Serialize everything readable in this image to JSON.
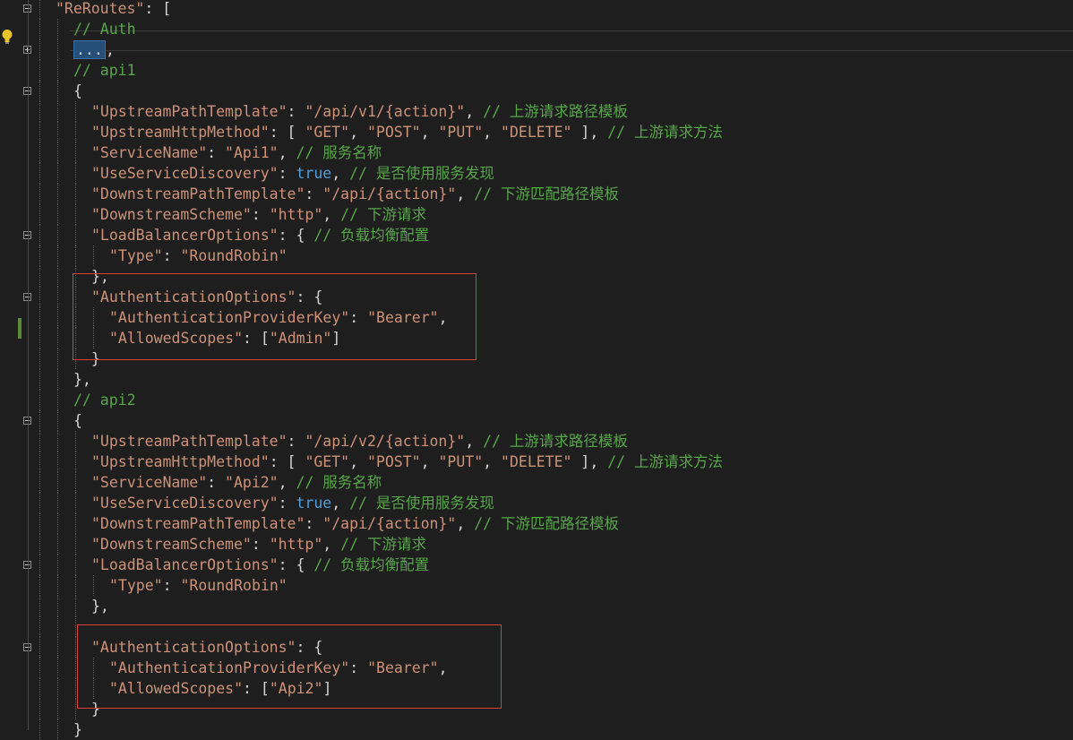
{
  "editor": {
    "language": "json",
    "lines": [
      {
        "indent": 0,
        "tokens": [
          {
            "t": "\"ReRoutes\"",
            "c": "k"
          },
          {
            "t": ": [",
            "c": "p"
          }
        ],
        "fold": "minus"
      },
      {
        "indent": 1,
        "tokens": [
          {
            "t": "// Auth",
            "c": "c"
          }
        ]
      },
      {
        "indent": 1,
        "tokens": [
          {
            "t": "...",
            "c": "collapsed"
          },
          {
            "t": ",",
            "c": "p"
          }
        ],
        "fold": "plus"
      },
      {
        "indent": 1,
        "tokens": [
          {
            "t": "// api1",
            "c": "c"
          }
        ]
      },
      {
        "indent": 1,
        "tokens": [
          {
            "t": "{",
            "c": "p"
          }
        ],
        "fold": "minus"
      },
      {
        "indent": 2,
        "tokens": [
          {
            "t": "\"UpstreamPathTemplate\"",
            "c": "k"
          },
          {
            "t": ": ",
            "c": "p"
          },
          {
            "t": "\"/api/v1/{action}\"",
            "c": "s"
          },
          {
            "t": ", ",
            "c": "p"
          },
          {
            "t": "// 上游请求路径模板",
            "c": "c"
          }
        ]
      },
      {
        "indent": 2,
        "tokens": [
          {
            "t": "\"UpstreamHttpMethod\"",
            "c": "k"
          },
          {
            "t": ": [ ",
            "c": "p"
          },
          {
            "t": "\"GET\"",
            "c": "s"
          },
          {
            "t": ", ",
            "c": "p"
          },
          {
            "t": "\"POST\"",
            "c": "s"
          },
          {
            "t": ", ",
            "c": "p"
          },
          {
            "t": "\"PUT\"",
            "c": "s"
          },
          {
            "t": ", ",
            "c": "p"
          },
          {
            "t": "\"DELETE\"",
            "c": "s"
          },
          {
            "t": " ], ",
            "c": "p"
          },
          {
            "t": "// 上游请求方法",
            "c": "c"
          }
        ]
      },
      {
        "indent": 2,
        "tokens": [
          {
            "t": "\"ServiceName\"",
            "c": "k"
          },
          {
            "t": ": ",
            "c": "p"
          },
          {
            "t": "\"Api1\"",
            "c": "s"
          },
          {
            "t": ", ",
            "c": "p"
          },
          {
            "t": "// 服务名称",
            "c": "c"
          }
        ]
      },
      {
        "indent": 2,
        "tokens": [
          {
            "t": "\"UseServiceDiscovery\"",
            "c": "k"
          },
          {
            "t": ": ",
            "c": "p"
          },
          {
            "t": "true",
            "c": "b"
          },
          {
            "t": ", ",
            "c": "p"
          },
          {
            "t": "// 是否使用服务发现",
            "c": "c"
          }
        ]
      },
      {
        "indent": 2,
        "tokens": [
          {
            "t": "\"DownstreamPathTemplate\"",
            "c": "k"
          },
          {
            "t": ": ",
            "c": "p"
          },
          {
            "t": "\"/api/{action}\"",
            "c": "s"
          },
          {
            "t": ", ",
            "c": "p"
          },
          {
            "t": "// 下游匹配路径模板",
            "c": "c"
          }
        ]
      },
      {
        "indent": 2,
        "tokens": [
          {
            "t": "\"DownstreamScheme\"",
            "c": "k"
          },
          {
            "t": ": ",
            "c": "p"
          },
          {
            "t": "\"http\"",
            "c": "s"
          },
          {
            "t": ", ",
            "c": "p"
          },
          {
            "t": "// 下游请求",
            "c": "c"
          }
        ]
      },
      {
        "indent": 2,
        "tokens": [
          {
            "t": "\"LoadBalancerOptions\"",
            "c": "k"
          },
          {
            "t": ": { ",
            "c": "p"
          },
          {
            "t": "// 负载均衡配置",
            "c": "c"
          }
        ],
        "fold": "minus"
      },
      {
        "indent": 3,
        "tokens": [
          {
            "t": "\"Type\"",
            "c": "k"
          },
          {
            "t": ": ",
            "c": "p"
          },
          {
            "t": "\"RoundRobin\"",
            "c": "s"
          }
        ]
      },
      {
        "indent": 2,
        "tokens": [
          {
            "t": "},",
            "c": "p"
          }
        ]
      },
      {
        "indent": 2,
        "tokens": [
          {
            "t": "\"AuthenticationOptions\"",
            "c": "k"
          },
          {
            "t": ": {",
            "c": "p"
          }
        ],
        "fold": "minus"
      },
      {
        "indent": 3,
        "tokens": [
          {
            "t": "\"AuthenticationProviderKey\"",
            "c": "k"
          },
          {
            "t": ": ",
            "c": "p"
          },
          {
            "t": "\"Bearer\"",
            "c": "s"
          },
          {
            "t": ",",
            "c": "p"
          }
        ]
      },
      {
        "indent": 3,
        "tokens": [
          {
            "t": "\"AllowedScopes\"",
            "c": "k"
          },
          {
            "t": ": [",
            "c": "p"
          },
          {
            "t": "\"Admin\"",
            "c": "s"
          },
          {
            "t": "]",
            "c": "p"
          }
        ]
      },
      {
        "indent": 2,
        "tokens": [
          {
            "t": "}",
            "c": "p"
          }
        ]
      },
      {
        "indent": 1,
        "tokens": [
          {
            "t": "},",
            "c": "p"
          }
        ]
      },
      {
        "indent": 1,
        "tokens": [
          {
            "t": "// api2",
            "c": "c"
          }
        ]
      },
      {
        "indent": 1,
        "tokens": [
          {
            "t": "{",
            "c": "p"
          }
        ],
        "fold": "minus"
      },
      {
        "indent": 2,
        "tokens": [
          {
            "t": "\"UpstreamPathTemplate\"",
            "c": "k"
          },
          {
            "t": ": ",
            "c": "p"
          },
          {
            "t": "\"/api/v2/{action}\"",
            "c": "s"
          },
          {
            "t": ", ",
            "c": "p"
          },
          {
            "t": "// 上游请求路径模板",
            "c": "c"
          }
        ]
      },
      {
        "indent": 2,
        "tokens": [
          {
            "t": "\"UpstreamHttpMethod\"",
            "c": "k"
          },
          {
            "t": ": [ ",
            "c": "p"
          },
          {
            "t": "\"GET\"",
            "c": "s"
          },
          {
            "t": ", ",
            "c": "p"
          },
          {
            "t": "\"POST\"",
            "c": "s"
          },
          {
            "t": ", ",
            "c": "p"
          },
          {
            "t": "\"PUT\"",
            "c": "s"
          },
          {
            "t": ", ",
            "c": "p"
          },
          {
            "t": "\"DELETE\"",
            "c": "s"
          },
          {
            "t": " ], ",
            "c": "p"
          },
          {
            "t": "// 上游请求方法",
            "c": "c"
          }
        ]
      },
      {
        "indent": 2,
        "tokens": [
          {
            "t": "\"ServiceName\"",
            "c": "k"
          },
          {
            "t": ": ",
            "c": "p"
          },
          {
            "t": "\"Api2\"",
            "c": "s"
          },
          {
            "t": ", ",
            "c": "p"
          },
          {
            "t": "// 服务名称",
            "c": "c"
          }
        ]
      },
      {
        "indent": 2,
        "tokens": [
          {
            "t": "\"UseServiceDiscovery\"",
            "c": "k"
          },
          {
            "t": ": ",
            "c": "p"
          },
          {
            "t": "true",
            "c": "b"
          },
          {
            "t": ", ",
            "c": "p"
          },
          {
            "t": "// 是否使用服务发现",
            "c": "c"
          }
        ]
      },
      {
        "indent": 2,
        "tokens": [
          {
            "t": "\"DownstreamPathTemplate\"",
            "c": "k"
          },
          {
            "t": ": ",
            "c": "p"
          },
          {
            "t": "\"/api/{action}\"",
            "c": "s"
          },
          {
            "t": ", ",
            "c": "p"
          },
          {
            "t": "// 下游匹配路径模板",
            "c": "c"
          }
        ]
      },
      {
        "indent": 2,
        "tokens": [
          {
            "t": "\"DownstreamScheme\"",
            "c": "k"
          },
          {
            "t": ": ",
            "c": "p"
          },
          {
            "t": "\"http\"",
            "c": "s"
          },
          {
            "t": ", ",
            "c": "p"
          },
          {
            "t": "// 下游请求",
            "c": "c"
          }
        ]
      },
      {
        "indent": 2,
        "tokens": [
          {
            "t": "\"LoadBalancerOptions\"",
            "c": "k"
          },
          {
            "t": ": { ",
            "c": "p"
          },
          {
            "t": "// 负载均衡配置",
            "c": "c"
          }
        ],
        "fold": "minus"
      },
      {
        "indent": 3,
        "tokens": [
          {
            "t": "\"Type\"",
            "c": "k"
          },
          {
            "t": ": ",
            "c": "p"
          },
          {
            "t": "\"RoundRobin\"",
            "c": "s"
          }
        ]
      },
      {
        "indent": 2,
        "tokens": [
          {
            "t": "},",
            "c": "p"
          }
        ]
      },
      {
        "indent": 2,
        "tokens": []
      },
      {
        "indent": 2,
        "tokens": [
          {
            "t": "\"AuthenticationOptions\"",
            "c": "k"
          },
          {
            "t": ": {",
            "c": "p"
          }
        ],
        "fold": "minus"
      },
      {
        "indent": 3,
        "tokens": [
          {
            "t": "\"AuthenticationProviderKey\"",
            "c": "k"
          },
          {
            "t": ": ",
            "c": "p"
          },
          {
            "t": "\"Bearer\"",
            "c": "s"
          },
          {
            "t": ",",
            "c": "p"
          }
        ]
      },
      {
        "indent": 3,
        "tokens": [
          {
            "t": "\"AllowedScopes\"",
            "c": "k"
          },
          {
            "t": ": [",
            "c": "p"
          },
          {
            "t": "\"Api2\"",
            "c": "s"
          },
          {
            "t": "]",
            "c": "p"
          }
        ]
      },
      {
        "indent": 2,
        "tokens": [
          {
            "t": "}",
            "c": "p"
          }
        ]
      },
      {
        "indent": 1,
        "tokens": [
          {
            "t": "}",
            "c": "p"
          }
        ]
      }
    ]
  },
  "colors": {
    "background": "#1e1e1e",
    "string": "#ce9178",
    "comment": "#57a64a",
    "keyword": "#569cd6",
    "highlight_box": "#d9403a"
  },
  "icons": {
    "lightbulb": "lightbulb-icon"
  }
}
